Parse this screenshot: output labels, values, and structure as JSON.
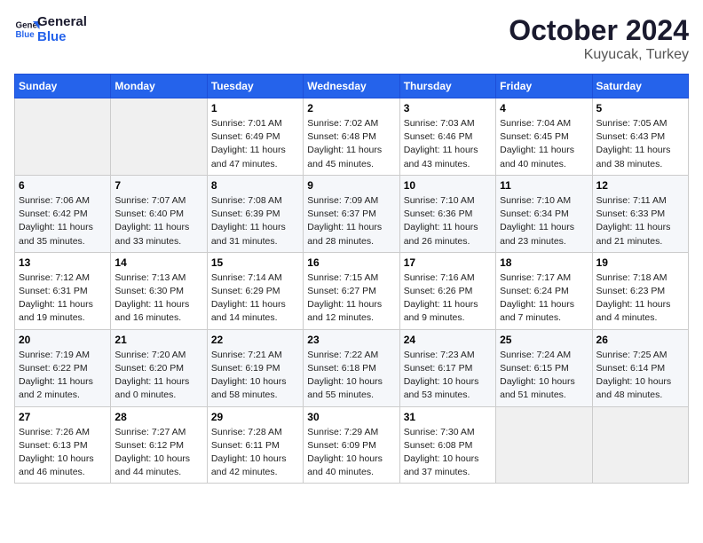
{
  "header": {
    "logo_line1": "General",
    "logo_line2": "Blue",
    "month": "October 2024",
    "location": "Kuyucak, Turkey"
  },
  "days_of_week": [
    "Sunday",
    "Monday",
    "Tuesday",
    "Wednesday",
    "Thursday",
    "Friday",
    "Saturday"
  ],
  "weeks": [
    [
      {
        "day": "",
        "info": ""
      },
      {
        "day": "",
        "info": ""
      },
      {
        "day": "1",
        "info": "Sunrise: 7:01 AM\nSunset: 6:49 PM\nDaylight: 11 hours and 47 minutes."
      },
      {
        "day": "2",
        "info": "Sunrise: 7:02 AM\nSunset: 6:48 PM\nDaylight: 11 hours and 45 minutes."
      },
      {
        "day": "3",
        "info": "Sunrise: 7:03 AM\nSunset: 6:46 PM\nDaylight: 11 hours and 43 minutes."
      },
      {
        "day": "4",
        "info": "Sunrise: 7:04 AM\nSunset: 6:45 PM\nDaylight: 11 hours and 40 minutes."
      },
      {
        "day": "5",
        "info": "Sunrise: 7:05 AM\nSunset: 6:43 PM\nDaylight: 11 hours and 38 minutes."
      }
    ],
    [
      {
        "day": "6",
        "info": "Sunrise: 7:06 AM\nSunset: 6:42 PM\nDaylight: 11 hours and 35 minutes."
      },
      {
        "day": "7",
        "info": "Sunrise: 7:07 AM\nSunset: 6:40 PM\nDaylight: 11 hours and 33 minutes."
      },
      {
        "day": "8",
        "info": "Sunrise: 7:08 AM\nSunset: 6:39 PM\nDaylight: 11 hours and 31 minutes."
      },
      {
        "day": "9",
        "info": "Sunrise: 7:09 AM\nSunset: 6:37 PM\nDaylight: 11 hours and 28 minutes."
      },
      {
        "day": "10",
        "info": "Sunrise: 7:10 AM\nSunset: 6:36 PM\nDaylight: 11 hours and 26 minutes."
      },
      {
        "day": "11",
        "info": "Sunrise: 7:10 AM\nSunset: 6:34 PM\nDaylight: 11 hours and 23 minutes."
      },
      {
        "day": "12",
        "info": "Sunrise: 7:11 AM\nSunset: 6:33 PM\nDaylight: 11 hours and 21 minutes."
      }
    ],
    [
      {
        "day": "13",
        "info": "Sunrise: 7:12 AM\nSunset: 6:31 PM\nDaylight: 11 hours and 19 minutes."
      },
      {
        "day": "14",
        "info": "Sunrise: 7:13 AM\nSunset: 6:30 PM\nDaylight: 11 hours and 16 minutes."
      },
      {
        "day": "15",
        "info": "Sunrise: 7:14 AM\nSunset: 6:29 PM\nDaylight: 11 hours and 14 minutes."
      },
      {
        "day": "16",
        "info": "Sunrise: 7:15 AM\nSunset: 6:27 PM\nDaylight: 11 hours and 12 minutes."
      },
      {
        "day": "17",
        "info": "Sunrise: 7:16 AM\nSunset: 6:26 PM\nDaylight: 11 hours and 9 minutes."
      },
      {
        "day": "18",
        "info": "Sunrise: 7:17 AM\nSunset: 6:24 PM\nDaylight: 11 hours and 7 minutes."
      },
      {
        "day": "19",
        "info": "Sunrise: 7:18 AM\nSunset: 6:23 PM\nDaylight: 11 hours and 4 minutes."
      }
    ],
    [
      {
        "day": "20",
        "info": "Sunrise: 7:19 AM\nSunset: 6:22 PM\nDaylight: 11 hours and 2 minutes."
      },
      {
        "day": "21",
        "info": "Sunrise: 7:20 AM\nSunset: 6:20 PM\nDaylight: 11 hours and 0 minutes."
      },
      {
        "day": "22",
        "info": "Sunrise: 7:21 AM\nSunset: 6:19 PM\nDaylight: 10 hours and 58 minutes."
      },
      {
        "day": "23",
        "info": "Sunrise: 7:22 AM\nSunset: 6:18 PM\nDaylight: 10 hours and 55 minutes."
      },
      {
        "day": "24",
        "info": "Sunrise: 7:23 AM\nSunset: 6:17 PM\nDaylight: 10 hours and 53 minutes."
      },
      {
        "day": "25",
        "info": "Sunrise: 7:24 AM\nSunset: 6:15 PM\nDaylight: 10 hours and 51 minutes."
      },
      {
        "day": "26",
        "info": "Sunrise: 7:25 AM\nSunset: 6:14 PM\nDaylight: 10 hours and 48 minutes."
      }
    ],
    [
      {
        "day": "27",
        "info": "Sunrise: 7:26 AM\nSunset: 6:13 PM\nDaylight: 10 hours and 46 minutes."
      },
      {
        "day": "28",
        "info": "Sunrise: 7:27 AM\nSunset: 6:12 PM\nDaylight: 10 hours and 44 minutes."
      },
      {
        "day": "29",
        "info": "Sunrise: 7:28 AM\nSunset: 6:11 PM\nDaylight: 10 hours and 42 minutes."
      },
      {
        "day": "30",
        "info": "Sunrise: 7:29 AM\nSunset: 6:09 PM\nDaylight: 10 hours and 40 minutes."
      },
      {
        "day": "31",
        "info": "Sunrise: 7:30 AM\nSunset: 6:08 PM\nDaylight: 10 hours and 37 minutes."
      },
      {
        "day": "",
        "info": ""
      },
      {
        "day": "",
        "info": ""
      }
    ]
  ]
}
